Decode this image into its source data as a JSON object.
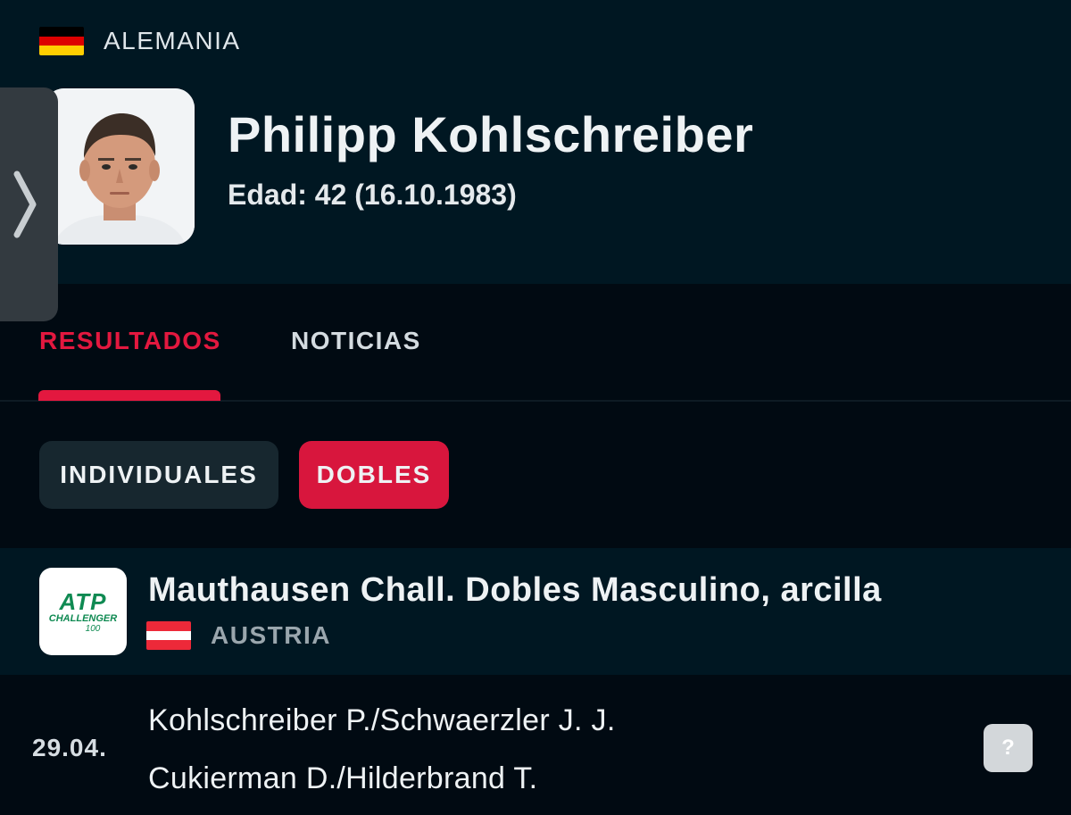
{
  "player": {
    "country": "ALEMANIA",
    "name": "Philipp Kohlschreiber",
    "age_line": "Edad: 42 (16.10.1983)"
  },
  "tabs": [
    {
      "label": "RESULTADOS",
      "active": true
    },
    {
      "label": "NOTICIAS",
      "active": false
    }
  ],
  "filters": [
    {
      "label": "INDIVIDUALES",
      "active": false
    },
    {
      "label": "DOBLES",
      "active": true
    }
  ],
  "tournament": {
    "name": "Mauthausen Chall. Dobles Masculino, arcilla",
    "country": "AUSTRIA",
    "logo": {
      "line1": "ATP",
      "line2": "CHALLENGER",
      "line3": "100"
    }
  },
  "match": {
    "date": "29.04.",
    "team1": "Kohlschreiber P./Schwaerzler J. J.",
    "team2": "Cukierman D./Hilderbrand T.",
    "status_icon": "?"
  },
  "colors": {
    "accent": "#e3183f",
    "header_bg": "#001722",
    "page_bg": "#010a12"
  },
  "icons": {
    "side_handle": "chevron-right-icon",
    "country_flag": "germany-flag-icon",
    "tournament_flag": "austria-flag-icon"
  }
}
